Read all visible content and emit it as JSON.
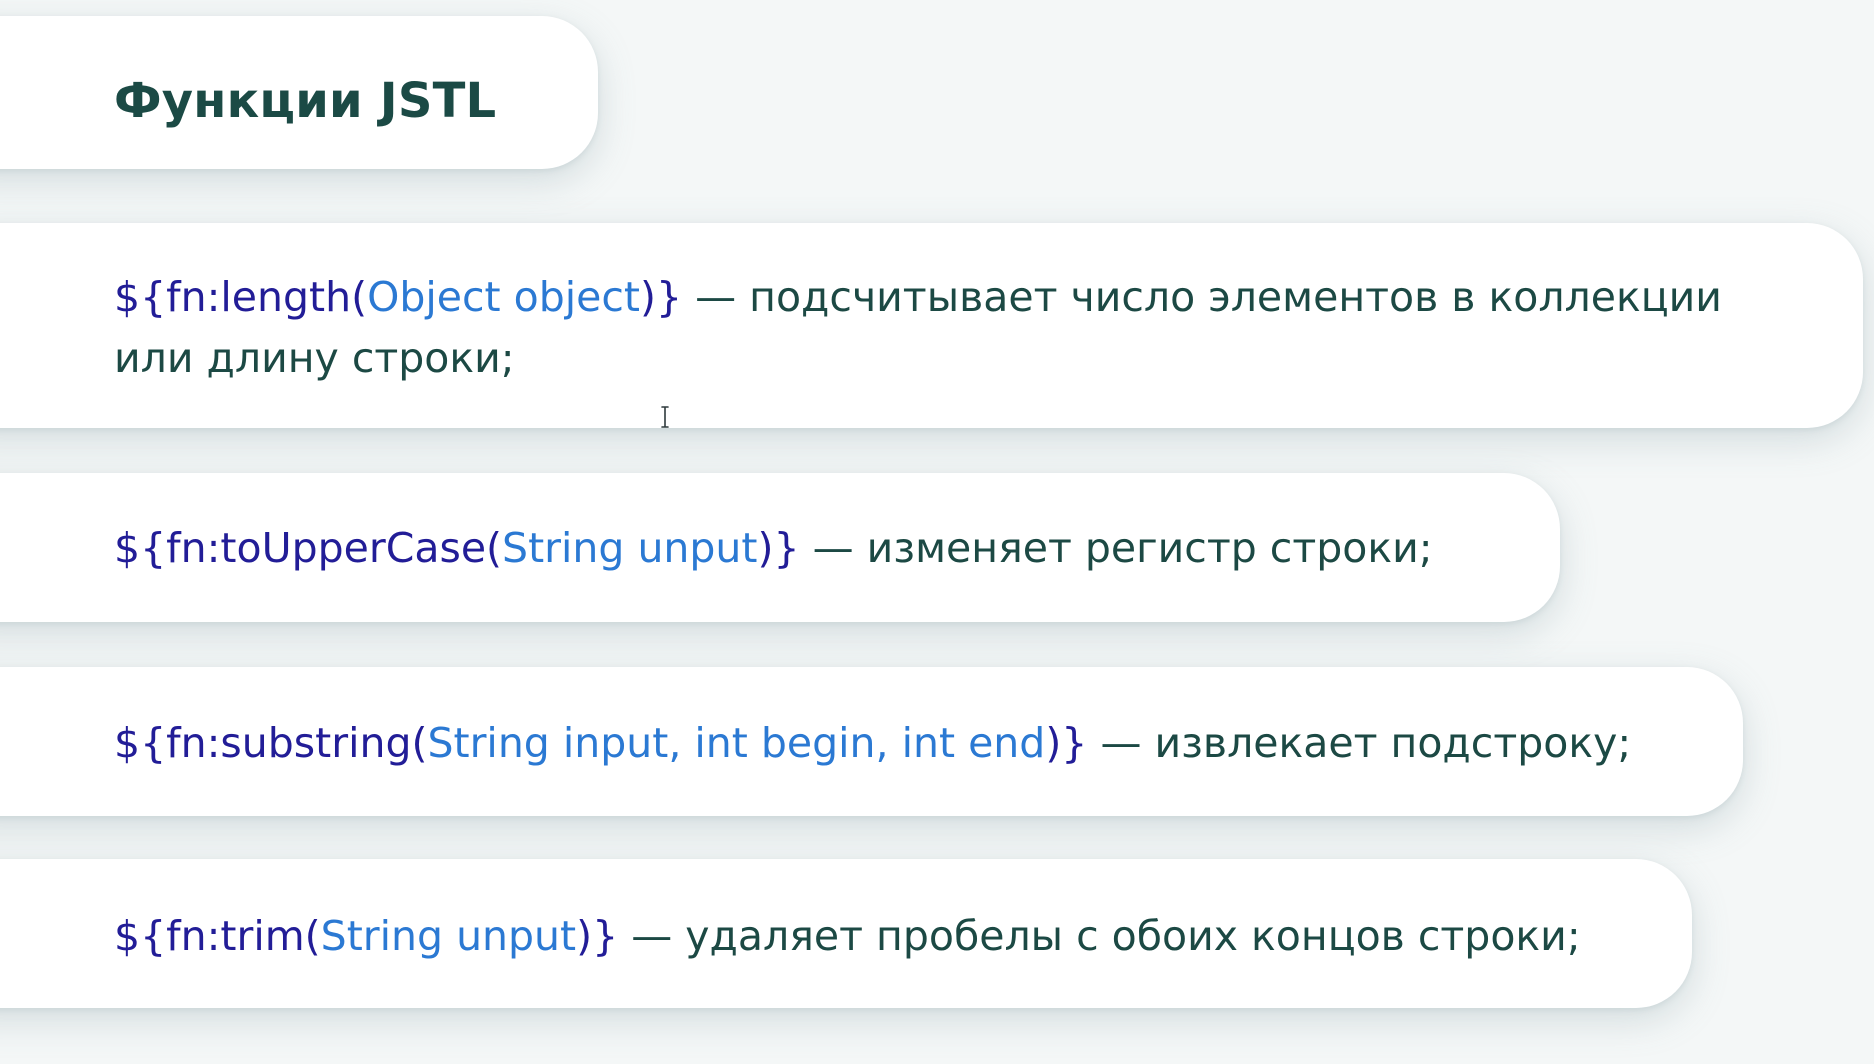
{
  "slide": {
    "title": "Функции JSTL",
    "items": [
      {
        "code_open": "${fn:length(",
        "code_args": "Object object",
        "code_close": ")}",
        "description_line1": " — подсчитывает число элементов в коллекции",
        "description_line2": "или длину строки;"
      },
      {
        "code_open": "${fn:toUpperCase(",
        "code_args": "String unput",
        "code_close": ")}",
        "description": " — изменяет регистр строки;"
      },
      {
        "code_open": "${fn:substring(",
        "code_args": "String input, int begin, int end",
        "code_close": ")}",
        "description": " — извлекает подстроку;"
      },
      {
        "code_open": "${fn:trim(",
        "code_args": "String unput",
        "code_close": ")}",
        "description": " — удаляет пробелы с обоих концов строки;"
      }
    ]
  },
  "colors": {
    "background": "#f4f7f7",
    "card": "#ffffff",
    "title": "#1b4a45",
    "text": "#1c4944",
    "code": "#221d97",
    "argument": "#2b79d3"
  },
  "icons": {
    "cursor": "text-cursor-icon"
  }
}
